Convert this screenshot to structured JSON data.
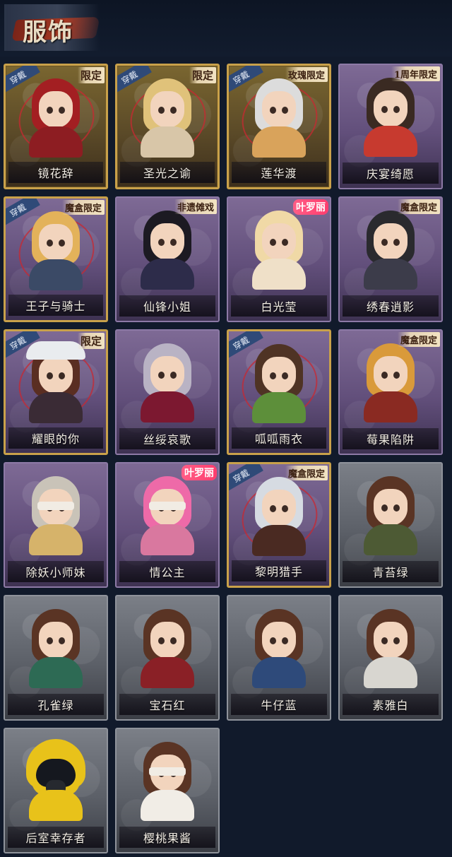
{
  "page": {
    "title": "服饰"
  },
  "badges": {
    "wear": "穿戴"
  },
  "cards": [
    {
      "name": "镜花辞",
      "frame": "gold",
      "wear": true,
      "tag": "限定",
      "tag_style": "gold",
      "hair": "#a31f22",
      "outfit": "#8d1d22"
    },
    {
      "name": "圣光之谕",
      "frame": "gold",
      "wear": true,
      "tag": "限定",
      "tag_style": "gold",
      "hair": "#e0c27a",
      "outfit": "#d8c6a8"
    },
    {
      "name": "莲华渡",
      "frame": "gold",
      "wear": true,
      "tag": "玫瑰限定",
      "tag_style": "gold",
      "hair": "#dcdcdc",
      "outfit": "#d9a35b"
    },
    {
      "name": "庆宴绮愿",
      "frame": "purple",
      "wear": false,
      "tag": "1周年限定",
      "tag_style": "gold",
      "hair": "#3a2a22",
      "outfit": "#c73a2f"
    },
    {
      "name": "王子与骑士",
      "frame": "purple-framed",
      "wear": true,
      "tag": "魔盒限定",
      "tag_style": "gold",
      "hair": "#e3b25a",
      "outfit": "#3b4a66"
    },
    {
      "name": "仙锋小姐",
      "frame": "purple",
      "wear": false,
      "tag": "非遗傩戏",
      "tag_style": "gold",
      "hair": "#1c1a22",
      "outfit": "#2d2c4a"
    },
    {
      "name": "白光莹",
      "frame": "purple",
      "wear": false,
      "tag": "叶罗丽",
      "tag_style": "pink",
      "hair": "#f0d9a6",
      "outfit": "#efe0c8"
    },
    {
      "name": "绣春逍影",
      "frame": "purple",
      "wear": false,
      "tag": "魔盒限定",
      "tag_style": "gold",
      "hair": "#2a2a2e",
      "outfit": "#3c3c4a"
    },
    {
      "name": "耀眼的你",
      "frame": "purple-framed",
      "wear": true,
      "tag": "限定",
      "tag_style": "gold",
      "hair": "#5a2e22",
      "outfit": "#3a2b35"
    },
    {
      "name": "丝绥哀歌",
      "frame": "purple",
      "wear": false,
      "tag": "",
      "tag_style": "none",
      "hair": "#b9b3c4",
      "outfit": "#7c1830"
    },
    {
      "name": "呱呱雨衣",
      "frame": "purple-framed",
      "wear": true,
      "tag": "",
      "tag_style": "none",
      "hair": "#4f3324",
      "outfit": "#5d8f3a"
    },
    {
      "name": "莓果陷阱",
      "frame": "purple",
      "wear": false,
      "tag": "魔盒限定",
      "tag_style": "gold",
      "hair": "#d99a3a",
      "outfit": "#8a2a22"
    },
    {
      "name": "除妖小师妹",
      "frame": "purple",
      "wear": false,
      "tag": "",
      "tag_style": "none",
      "hair": "#c9c3b8",
      "outfit": "#d6b36a"
    },
    {
      "name": "情公主",
      "frame": "purple",
      "wear": false,
      "tag": "叶罗丽",
      "tag_style": "pink",
      "hair": "#ee6aa8",
      "outfit": "#d9789f"
    },
    {
      "name": "黎明猎手",
      "frame": "purple-framed",
      "wear": true,
      "tag": "魔盒限定",
      "tag_style": "gold",
      "hair": "#d6dbe2",
      "outfit": "#4a2a22"
    },
    {
      "name": "青苔绿",
      "frame": "grey",
      "wear": false,
      "tag": "",
      "tag_style": "none",
      "hair": "#5a3424",
      "outfit": "#4d5a34"
    },
    {
      "name": "孔雀绿",
      "frame": "grey",
      "wear": false,
      "tag": "",
      "tag_style": "none",
      "hair": "#5a3424",
      "outfit": "#2d6a54"
    },
    {
      "name": "宝石红",
      "frame": "grey",
      "wear": false,
      "tag": "",
      "tag_style": "none",
      "hair": "#5a3424",
      "outfit": "#8a2026"
    },
    {
      "name": "牛仔蓝",
      "frame": "grey",
      "wear": false,
      "tag": "",
      "tag_style": "none",
      "hair": "#5a3424",
      "outfit": "#2e4a7a"
    },
    {
      "name": "素雅白",
      "frame": "grey",
      "wear": false,
      "tag": "",
      "tag_style": "none",
      "hair": "#5a3424",
      "outfit": "#d8d6d0"
    },
    {
      "name": "后室幸存者",
      "frame": "grey",
      "wear": false,
      "tag": "",
      "tag_style": "none",
      "hair": "#e8c21a",
      "outfit": "#e8c21a"
    },
    {
      "name": "樱桃果酱",
      "frame": "grey",
      "wear": false,
      "tag": "",
      "tag_style": "none",
      "hair": "#5a3424",
      "outfit": "#f1ede6"
    }
  ]
}
